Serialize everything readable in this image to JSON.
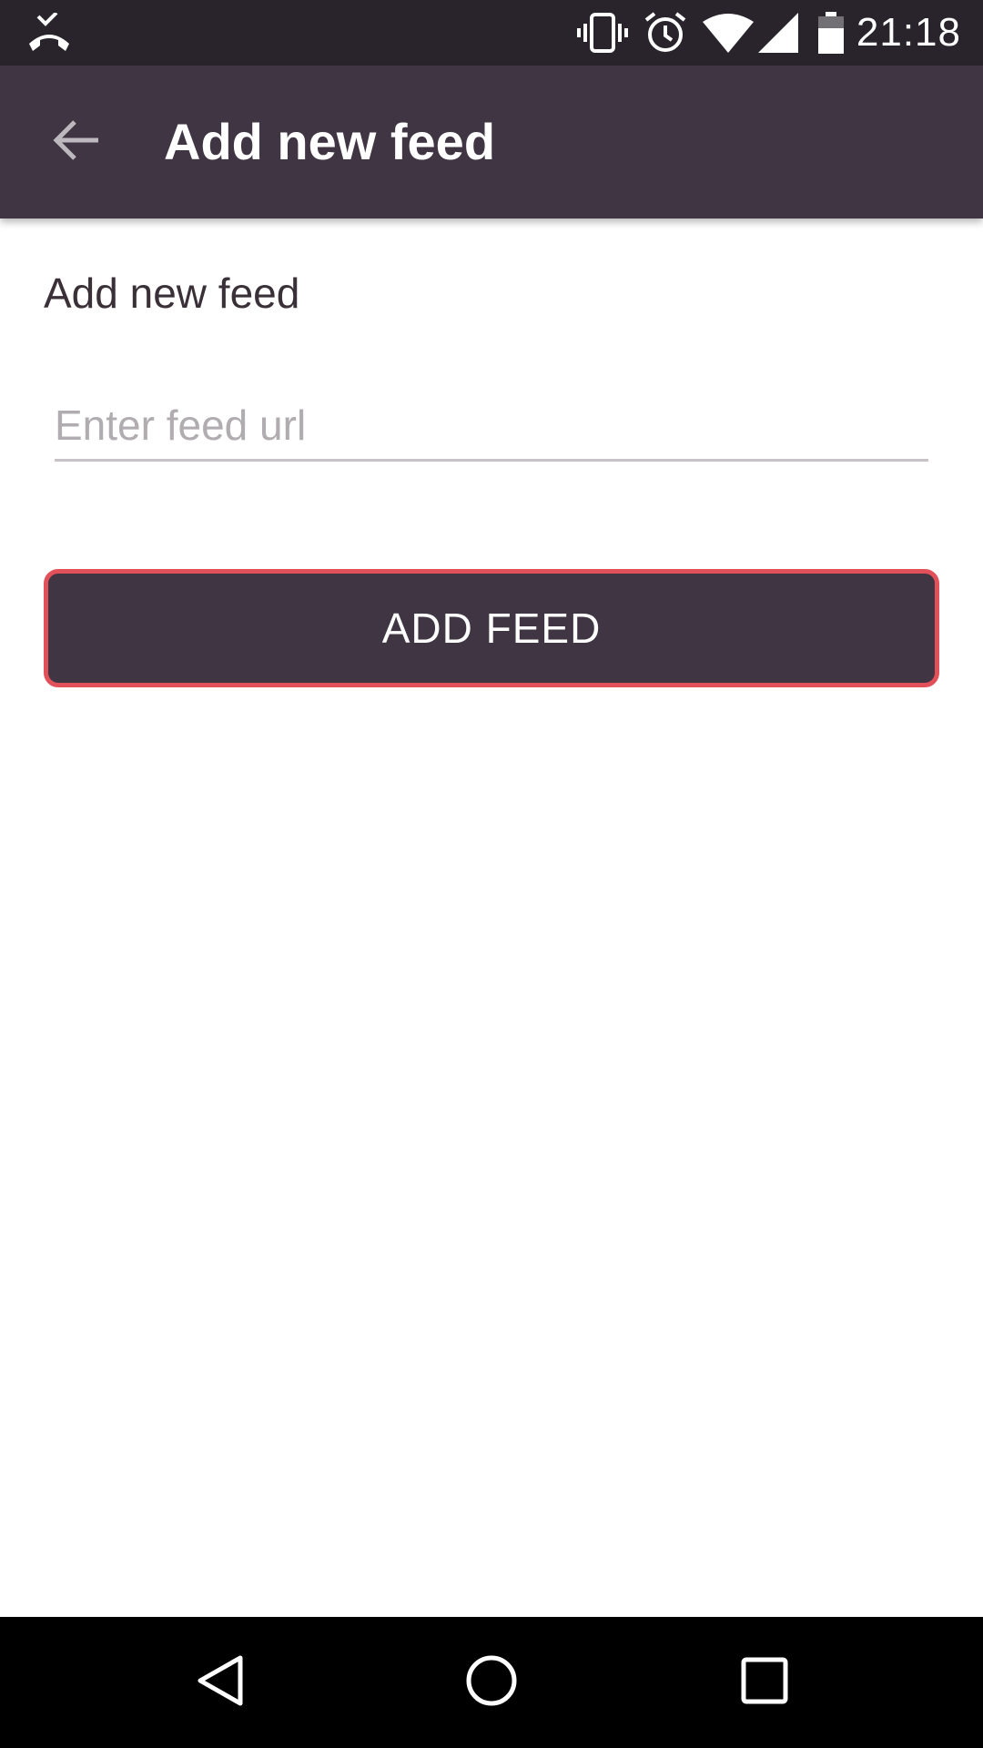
{
  "status_bar": {
    "time": "21:18",
    "icons": [
      "missed-call-icon",
      "vibrate-icon",
      "alarm-icon",
      "wifi-icon",
      "cell-signal-icon",
      "battery-icon"
    ]
  },
  "app_bar": {
    "title": "Add new feed",
    "back_icon": "arrow-back-icon",
    "background": "#403542"
  },
  "content": {
    "section_label": "Add new feed",
    "url_input": {
      "value": "",
      "placeholder": "Enter feed url"
    },
    "add_button_label": "ADD FEED",
    "button_border_color": "#e2505a"
  },
  "nav_bar": {
    "icons": [
      "nav-back-icon",
      "nav-home-icon",
      "nav-recents-icon"
    ]
  }
}
